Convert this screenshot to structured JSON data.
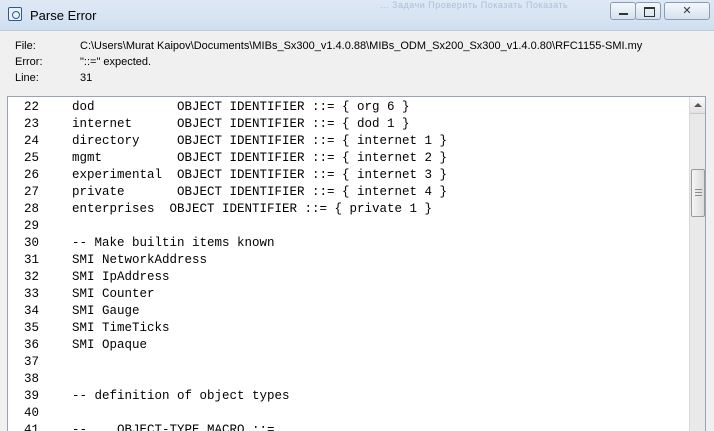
{
  "window": {
    "title": "Parse Error",
    "background_text": "... Задачи   Проверить   Показать   Показать"
  },
  "colors": {
    "titlebar": "#cfdff0",
    "pane_border": "#9aa4b0"
  },
  "icons": {
    "app": "app-icon",
    "minimize": "minimize-icon",
    "maximize": "maximize-icon",
    "close": "close-icon"
  },
  "controls": {
    "close_glyph": "✕"
  },
  "info": {
    "file_label": "File:",
    "file_value": "C:\\Users\\Murat Kaipov\\Documents\\MIBs_Sx300_v1.4.0.88\\MIBs_ODM_Sx200_Sx300_v1.4.0.80\\RFC1155-SMI.my",
    "error_label": "Error:",
    "error_value": "\"::=\" expected.",
    "line_label": "Line:",
    "line_value": "31"
  },
  "code_lines": [
    {
      "num": "22",
      "text": "dod           OBJECT IDENTIFIER ::= { org 6 }"
    },
    {
      "num": "23",
      "text": "internet      OBJECT IDENTIFIER ::= { dod 1 }"
    },
    {
      "num": "24",
      "text": "directory     OBJECT IDENTIFIER ::= { internet 1 }"
    },
    {
      "num": "25",
      "text": "mgmt          OBJECT IDENTIFIER ::= { internet 2 }"
    },
    {
      "num": "26",
      "text": "experimental  OBJECT IDENTIFIER ::= { internet 3 }"
    },
    {
      "num": "27",
      "text": "private       OBJECT IDENTIFIER ::= { internet 4 }"
    },
    {
      "num": "28",
      "text": "enterprises  OBJECT IDENTIFIER ::= { private 1 }"
    },
    {
      "num": "29",
      "text": ""
    },
    {
      "num": "30",
      "text": "-- Make builtin items known"
    },
    {
      "num": "31",
      "text": "SMI NetworkAddress"
    },
    {
      "num": "32",
      "text": "SMI IpAddress"
    },
    {
      "num": "33",
      "text": "SMI Counter"
    },
    {
      "num": "34",
      "text": "SMI Gauge"
    },
    {
      "num": "35",
      "text": "SMI TimeTicks"
    },
    {
      "num": "36",
      "text": "SMI Opaque"
    },
    {
      "num": "37",
      "text": ""
    },
    {
      "num": "38",
      "text": ""
    },
    {
      "num": "39",
      "text": "-- definition of object types"
    },
    {
      "num": "40",
      "text": ""
    },
    {
      "num": "41",
      "text": "--    OBJECT-TYPE MACRO ::="
    }
  ]
}
